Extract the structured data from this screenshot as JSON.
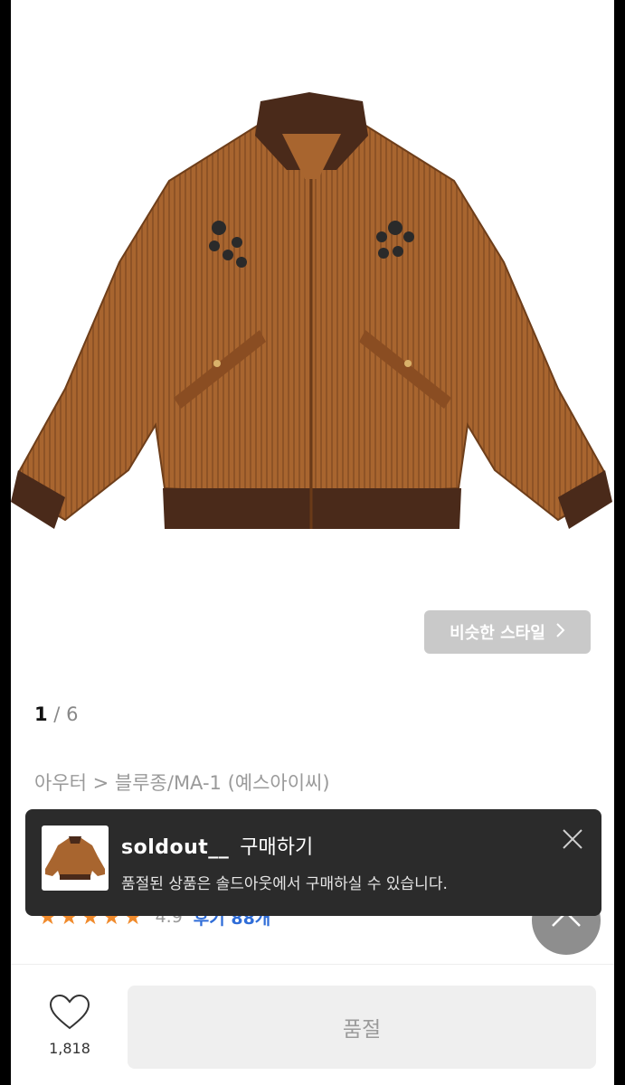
{
  "product": {
    "image_alt": "corduroy bomber jacket",
    "similar_style_label": "비슷한 스타일",
    "pager": {
      "current": "1",
      "separator": " / ",
      "total": "6"
    },
    "breadcrumb": "아우터 > 블루종/MA-1 (예스아이씨)",
    "rating": {
      "stars": "★★★★★",
      "score": "4.9",
      "reviews": "후기 88개"
    }
  },
  "toast": {
    "brand": "soldout__",
    "title": "구매하기",
    "description": "품절된 상품은 솔드아웃에서 구매하실 수 있습니다."
  },
  "bottom_bar": {
    "like_count": "1,818",
    "soldout_label": "품절"
  },
  "colors": {
    "accent_star": "#f08a2b",
    "review_link": "#2f6dd8",
    "toast_bg": "#2b2b2b",
    "jacket": "#a0622e",
    "rib": "#4a2a1a"
  },
  "icons": [
    "chevron-right-icon",
    "close-icon",
    "arrow-up-icon",
    "heart-icon"
  ]
}
